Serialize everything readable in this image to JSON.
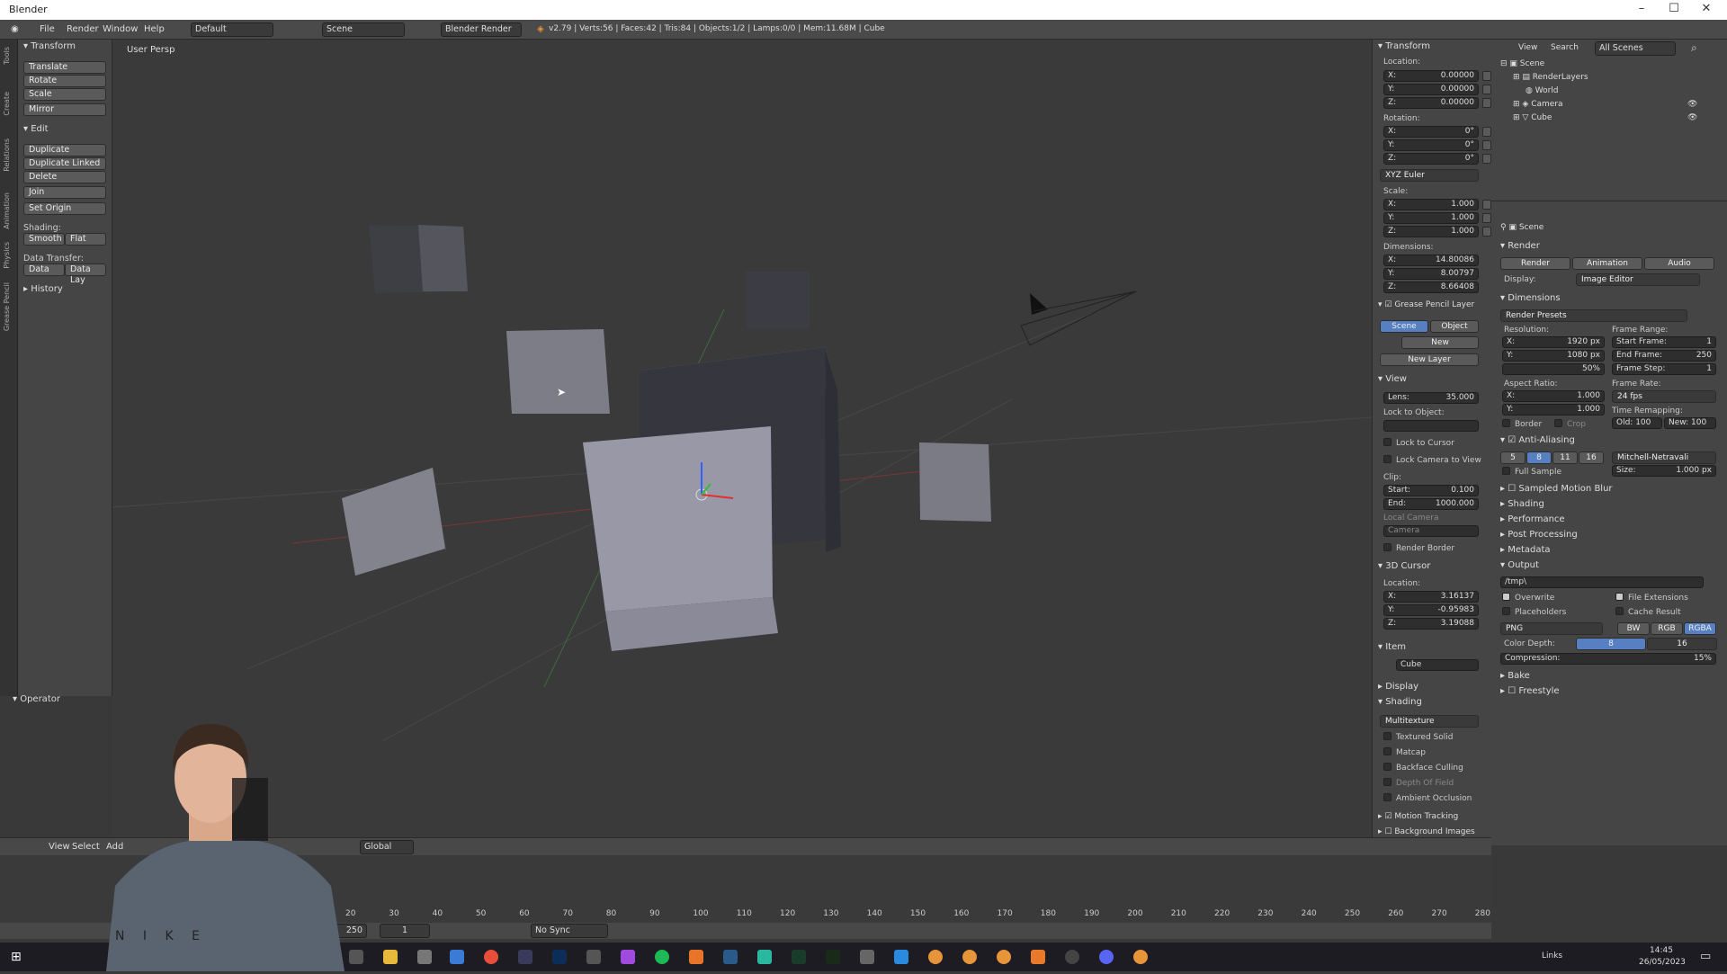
{
  "title_bar": {
    "app": "Blender"
  },
  "info_bar": {
    "menus": [
      "File",
      "Render",
      "Window",
      "Help"
    ],
    "layout": "Default",
    "scene": "Scene",
    "engine": "Blender Render",
    "stats": "v2.79 | Verts:56 | Faces:42 | Tris:84 | Objects:1/2 | Lamps:0/0 | Mem:11.68M | Cube"
  },
  "side_tabs": [
    "Tools",
    "Create",
    "Relations",
    "Animation",
    "Physics",
    "Grease Pencil"
  ],
  "tool_shelf": {
    "transform_header": "Transform",
    "transform": [
      "Translate",
      "Rotate",
      "Scale",
      "Mirror"
    ],
    "edit_header": "Edit",
    "edit": [
      "Duplicate",
      "Duplicate Linked",
      "Delete",
      "Join",
      "Set Origin"
    ],
    "shading_label": "Shading:",
    "smooth": "Smooth",
    "flat": "Flat",
    "data_transfer_label": "Data Transfer:",
    "data": "Data",
    "data_lay": "Data Lay",
    "history": "History",
    "operator": "Operator"
  },
  "viewport": {
    "title": "User Persp"
  },
  "n_panel": {
    "transform": "Transform",
    "location": "Location:",
    "loc": [
      [
        "X:",
        "0.00000"
      ],
      [
        "Y:",
        "0.00000"
      ],
      [
        "Z:",
        "0.00000"
      ]
    ],
    "rotation": "Rotation:",
    "rot": [
      [
        "X:",
        "0°"
      ],
      [
        "Y:",
        "0°"
      ],
      [
        "Z:",
        "0°"
      ]
    ],
    "rot_mode": "XYZ Euler",
    "scale": "Scale:",
    "scl": [
      [
        "X:",
        "1.000"
      ],
      [
        "Y:",
        "1.000"
      ],
      [
        "Z:",
        "1.000"
      ]
    ],
    "dimensions": "Dimensions:",
    "dim": [
      [
        "X:",
        "14.80086"
      ],
      [
        "Y:",
        "8.00797"
      ],
      [
        "Z:",
        "8.66408"
      ]
    ],
    "grease_pencil": "Grease Pencil Layer",
    "gp_scene": "Scene",
    "gp_object": "Object",
    "gp_new": "New",
    "gp_new_layer": "New Layer",
    "view": "View",
    "lens": [
      "Lens:",
      "35.000"
    ],
    "lock_to_object": "Lock to Object:",
    "lock_to_cursor": "Lock to Cursor",
    "lock_camera": "Lock Camera to View",
    "clip": "Clip:",
    "clip_start": [
      "Start:",
      "0.100"
    ],
    "clip_end": [
      "End:",
      "1000.000"
    ],
    "local_camera": "Local Camera",
    "camera": "Camera",
    "render_border": "Render Border",
    "cursor": "3D Cursor",
    "cursor_location": "Location:",
    "cur": [
      [
        "X:",
        "3.16137"
      ],
      [
        "Y:",
        "-0.95983"
      ],
      [
        "Z:",
        "3.19088"
      ]
    ],
    "item": "Item",
    "item_name": "Cube",
    "display": "Display",
    "shading": "Shading",
    "shading_mode": "Multitexture",
    "textured_solid": "Textured Solid",
    "matcap": "Matcap",
    "backface": "Backface Culling",
    "dof": "Depth Of Field",
    "ao": "Ambient Occlusion",
    "motion_tracking": "Motion Tracking",
    "bg_images": "Background Images"
  },
  "outliner": {
    "view": "View",
    "search": "Search",
    "filter": "All Scenes",
    "items": [
      "Scene",
      "RenderLayers",
      "World",
      "Camera",
      "Cube"
    ]
  },
  "properties": {
    "scene": "Scene",
    "render": "Render",
    "render_btn": "Render",
    "animation_btn": "Animation",
    "audio_btn": "Audio",
    "display_label": "Display:",
    "display_value": "Image Editor",
    "dimensions": "Dimensions",
    "presets": "Render Presets",
    "resolution": "Resolution:",
    "res_x": [
      "X:",
      "1920 px"
    ],
    "res_y": [
      "Y:",
      "1080 px"
    ],
    "res_pct": "50%",
    "frame_range": "Frame Range:",
    "start_frame": [
      "Start Frame:",
      "1"
    ],
    "end_frame": [
      "End Frame:",
      "250"
    ],
    "frame_step": [
      "Frame Step:",
      "1"
    ],
    "aspect": "Aspect Ratio:",
    "asp_x": [
      "X:",
      "1.000"
    ],
    "asp_y": [
      "Y:",
      "1.000"
    ],
    "frame_rate": "Frame Rate:",
    "fps": "24 fps",
    "time_remap": "Time Remapping:",
    "old": "Old: 100",
    "new": "New: 100",
    "border": "Border",
    "crop": "Crop",
    "aa": "Anti-Aliasing",
    "aa_samples": [
      "5",
      "8",
      "11",
      "16"
    ],
    "aa_filter": "Mitchell-Netravali",
    "full_sample": "Full Sample",
    "size": [
      "Size:",
      "1.000 px"
    ],
    "sampled_motion_blur": "Sampled Motion Blur",
    "shading": "Shading",
    "performance": "Performance",
    "post_processing": "Post Processing",
    "metadata": "Metadata",
    "output": "Output",
    "output_path": "/tmp\\",
    "overwrite": "Overwrite",
    "file_ext": "File Extensions",
    "placeholders": "Placeholders",
    "cache_result": "Cache Result",
    "format": "PNG",
    "bw": "BW",
    "rgb": "RGB",
    "rgba": "RGBA",
    "color_depth": "Color Depth:",
    "depth_8": "8",
    "depth_16": "16",
    "compression": [
      "Compression:",
      "15%"
    ],
    "bake": "Bake",
    "freestyle": "Freestyle"
  },
  "viewport_header": {
    "view": "View",
    "select": "Select",
    "add": "Add",
    "orientation": "Global"
  },
  "timeline": {
    "ticks": [
      "20",
      "30",
      "40",
      "50",
      "60",
      "70",
      "80",
      "90",
      "100",
      "110",
      "120",
      "130",
      "140",
      "150",
      "160",
      "170",
      "180",
      "190",
      "200",
      "210",
      "220",
      "230",
      "240",
      "250",
      "260",
      "270",
      "280"
    ],
    "end": "250",
    "current": "1",
    "sync": "No Sync"
  },
  "taskbar": {
    "links": "Links",
    "time": "14:45",
    "date": "26/05/2023"
  },
  "webcam": {
    "shirt_text": "N I K E"
  }
}
